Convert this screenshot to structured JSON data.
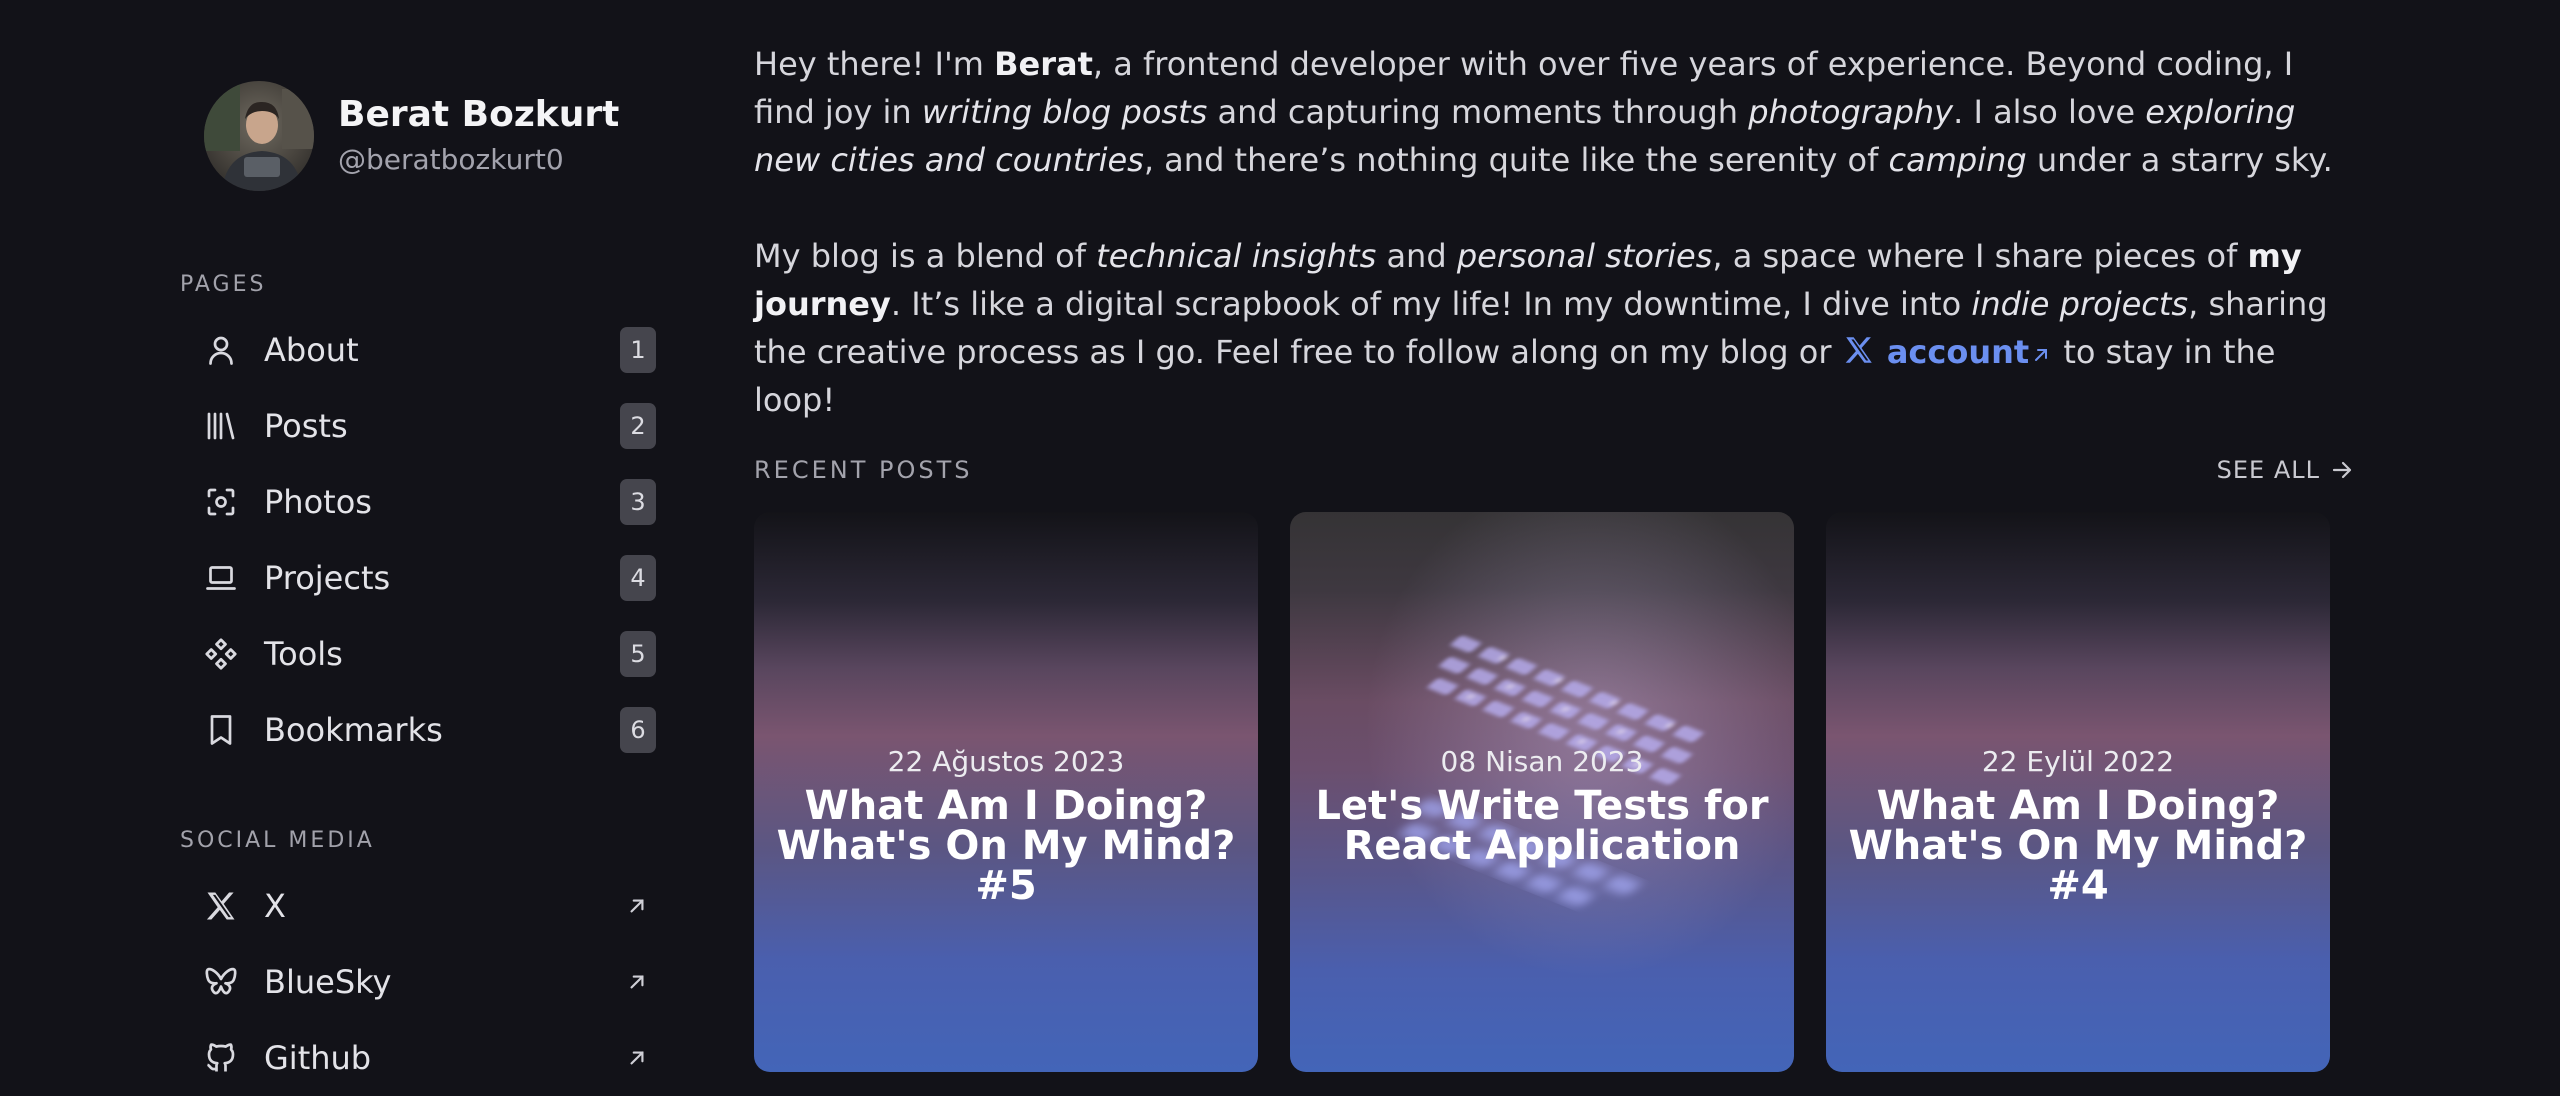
{
  "profile": {
    "name": "Berat Bozkurt",
    "handle": "@beratbozkurt0"
  },
  "sidebar": {
    "pages_label": "PAGES",
    "pages": [
      {
        "label": "About",
        "badge": "1",
        "icon": "user-icon"
      },
      {
        "label": "Posts",
        "badge": "2",
        "icon": "library-icon"
      },
      {
        "label": "Photos",
        "badge": "3",
        "icon": "camera-focus-icon"
      },
      {
        "label": "Projects",
        "badge": "4",
        "icon": "laptop-icon"
      },
      {
        "label": "Tools",
        "badge": "5",
        "icon": "tools-icon"
      },
      {
        "label": "Bookmarks",
        "badge": "6",
        "icon": "bookmark-icon"
      }
    ],
    "social_label": "SOCIAL MEDIA",
    "social": [
      {
        "label": "X",
        "icon": "x-logo-icon"
      },
      {
        "label": "BlueSky",
        "icon": "butterfly-icon"
      },
      {
        "label": "Github",
        "icon": "github-icon"
      }
    ]
  },
  "intro": {
    "p1": {
      "t1": "Hey there! I'm ",
      "b1": "Berat",
      "t2": ", a frontend developer with over five years of experience. Beyond coding, I find joy in ",
      "i1": "writing blog posts",
      "t3": " and capturing moments through ",
      "i2": "photography",
      "t4": ". I also love ",
      "i3": "exploring new cities and countries",
      "t5": ", and there’s nothing quite like the serenity of ",
      "i4": "camping",
      "t6": " under a starry sky."
    },
    "p2": {
      "t1": "My blog is a blend of ",
      "i1": "technical insights",
      "t2": " and ",
      "i2": "personal stories",
      "t3": ", a space where I share pieces of ",
      "b1": "my journey",
      "t4": ". It’s like a digital scrapbook of my life! In my downtime, I dive into ",
      "i3": "indie projects",
      "t5": ", sharing the creative process as I go. Feel free to follow along on my blog or ",
      "link": "account",
      "t6": " to stay in the loop!"
    }
  },
  "recent": {
    "title": "RECENT POSTS",
    "see_all": "SEE ALL",
    "posts": [
      {
        "date": "22 Ağustos 2023",
        "title": "What Am I Doing? What's On My Mind? #5"
      },
      {
        "date": "08 Nisan 2023",
        "title": "Let's Write Tests for React Application"
      },
      {
        "date": "22 Eylül 2022",
        "title": "What Am I Doing? What's On My Mind? #4"
      }
    ]
  },
  "colors": {
    "background": "#121218",
    "link": "#6b8ff0",
    "badge": "#45454d"
  }
}
